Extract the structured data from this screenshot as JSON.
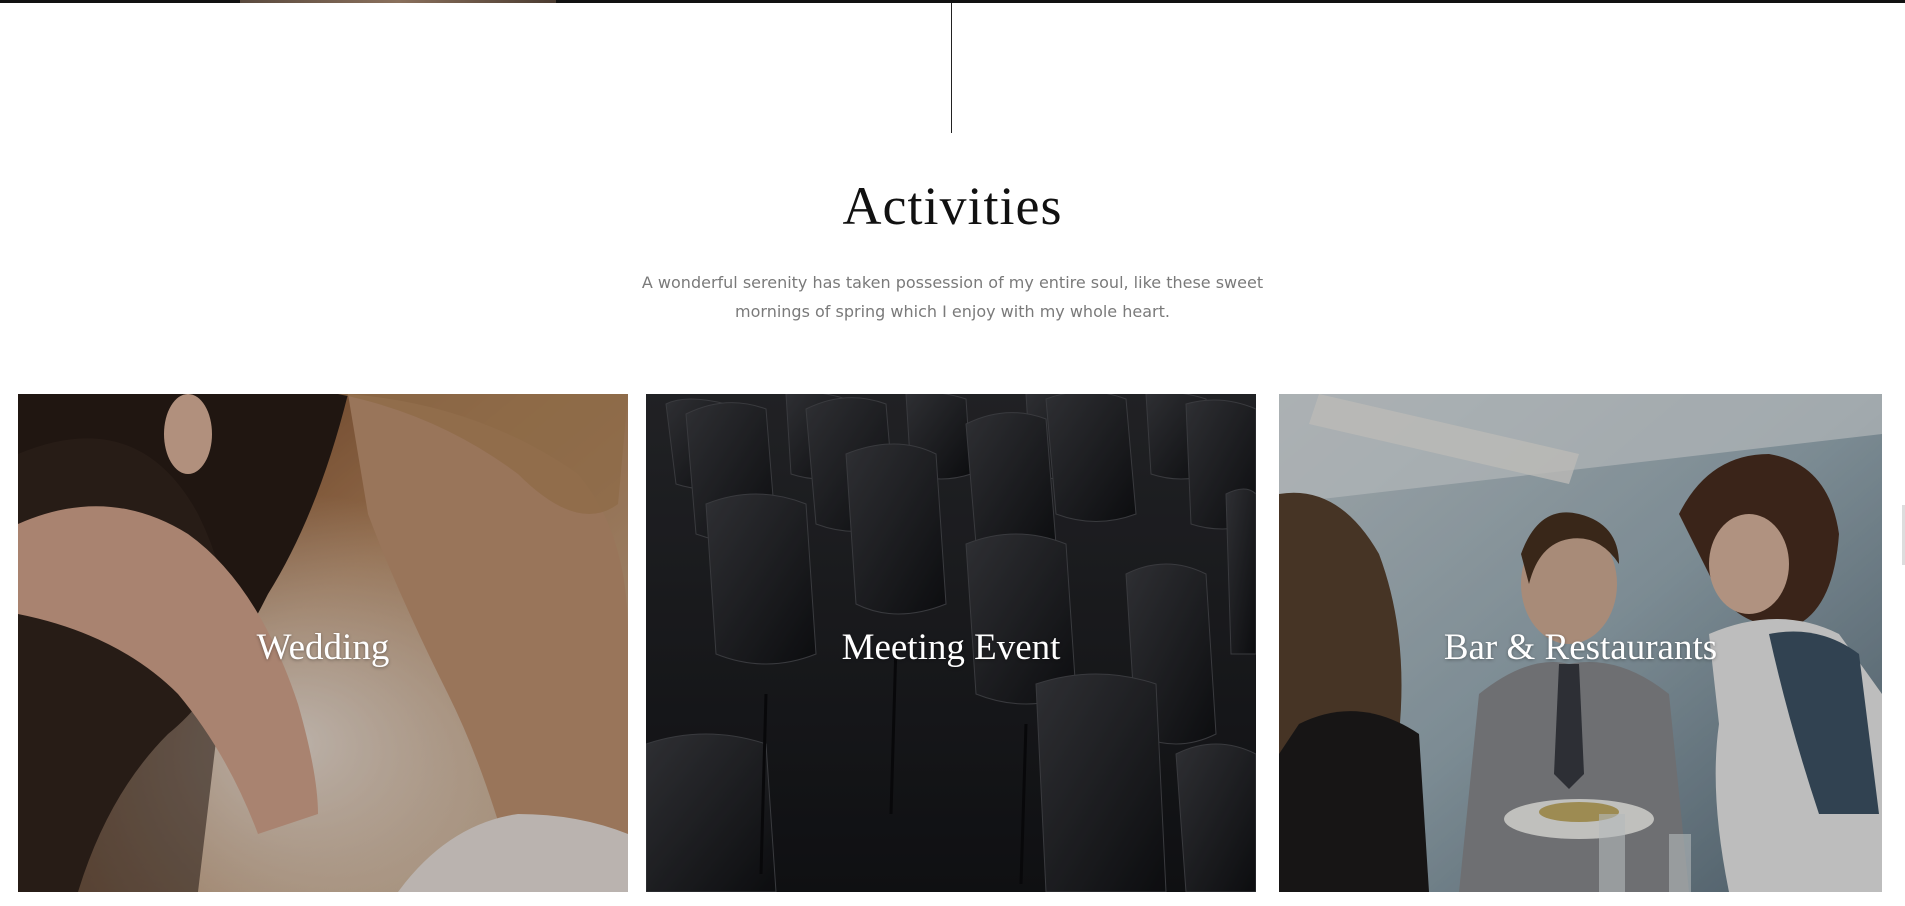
{
  "section": {
    "title": "Activities",
    "description": "A wonderful serenity has taken possession of my entire soul, like these sweet mornings of spring which I enjoy with my whole heart."
  },
  "cards": [
    {
      "label": "Wedding",
      "image": "wedding-couple-photo"
    },
    {
      "label": "Meeting Event",
      "image": "black-chairs-photo"
    },
    {
      "label": "Bar & Restaurants",
      "image": "restaurant-dining-photo"
    }
  ]
}
